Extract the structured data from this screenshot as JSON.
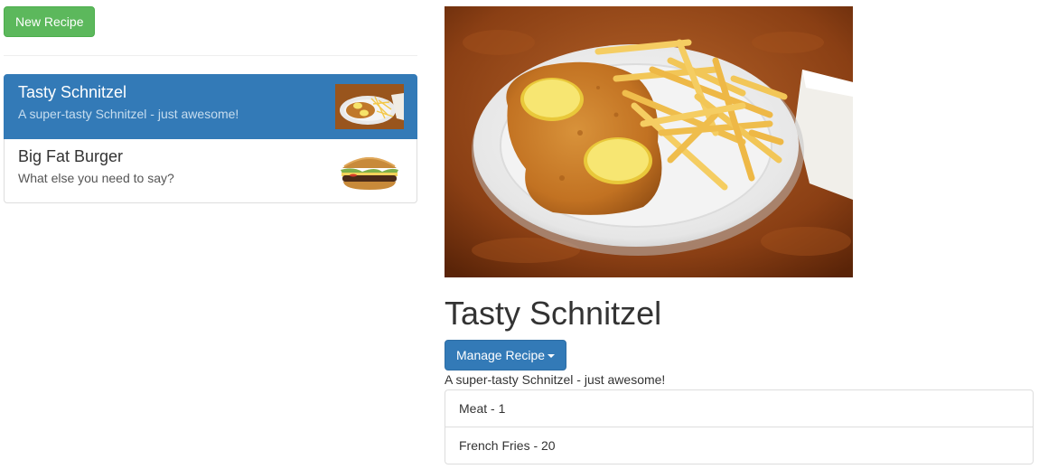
{
  "toolbar": {
    "new_recipe_label": "New Recipe"
  },
  "recipes": [
    {
      "name": "Tasty Schnitzel",
      "description": "A super-tasty Schnitzel - just awesome!",
      "active": true
    },
    {
      "name": "Big Fat Burger",
      "description": "What else you need to say?",
      "active": false
    }
  ],
  "detail": {
    "title": "Tasty Schnitzel",
    "manage_label": "Manage Recipe",
    "description": "A super-tasty Schnitzel - just awesome!",
    "ingredients": [
      "Meat - 1",
      "French Fries - 20"
    ]
  },
  "colors": {
    "success": "#5cb85c",
    "primary": "#337ab7",
    "border": "#dddddd"
  }
}
